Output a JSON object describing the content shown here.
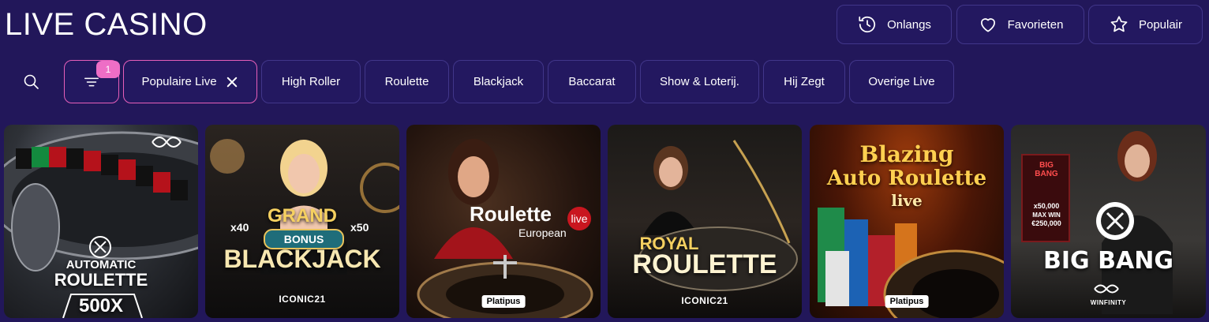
{
  "page": {
    "title": "LIVE CASINO"
  },
  "top_buttons": [
    {
      "label": "Onlangs",
      "icon": "history-icon"
    },
    {
      "label": "Favorieten",
      "icon": "heart-icon"
    },
    {
      "label": "Populair",
      "icon": "star-icon"
    }
  ],
  "filter": {
    "badge_count": "1"
  },
  "chips": [
    {
      "label": "Populaire Live",
      "active": true
    },
    {
      "label": "High Roller"
    },
    {
      "label": "Roulette"
    },
    {
      "label": "Blackjack"
    },
    {
      "label": "Baccarat"
    },
    {
      "label": "Show & Loterij."
    },
    {
      "label": "Hij Zegt"
    },
    {
      "label": "Overige Live"
    }
  ],
  "colors": {
    "background": "#22175a",
    "accent_pink": "#e65fb9",
    "border": "#41368a"
  },
  "games": [
    {
      "line1": "AUTOMATIC",
      "line2": "ROULETTE",
      "line3": "500X",
      "provider": ""
    },
    {
      "line1": "GRAND",
      "badge": "BONUS",
      "line2": "BLACKJACK",
      "mult_left": "x40",
      "mult_right": "x50",
      "provider": "ICONIC21"
    },
    {
      "line1": "Roulette",
      "live": "live",
      "line2": "European",
      "provider": "Platipus"
    },
    {
      "line1": "ROYAL",
      "line2": "ROULETTE",
      "provider": "ICONIC21"
    },
    {
      "line1": "Blazing",
      "line2": "Auto Roulette",
      "line3": "live",
      "provider": "Platipus"
    },
    {
      "line1": "BIG BANG",
      "sign1": "BIG",
      "sign2": "BANG",
      "sign3": "x50,000",
      "sign4": "MAX WIN",
      "sign5": "€250,000",
      "provider": "WINFINITY"
    }
  ]
}
